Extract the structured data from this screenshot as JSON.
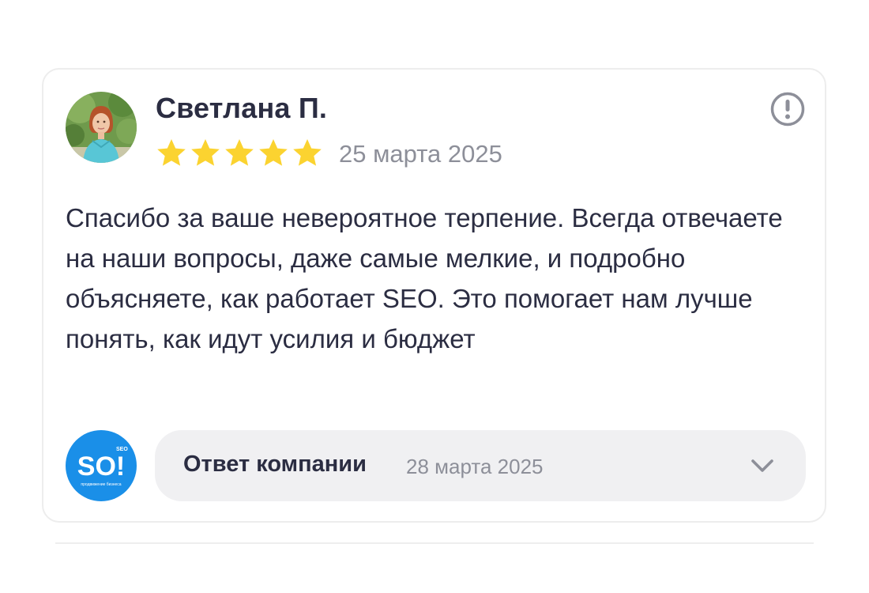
{
  "review": {
    "author_name": "Светлана П.",
    "rating": 5,
    "rating_max": 5,
    "date": "25 марта 2025",
    "text": "Спасибо за ваше невероятное терпение. Всегда отвечаете на наши вопросы, даже самые мелкие, и подробно объясняете, как работает SEO. Это помогает нам лучше понять, как идут усилия и бюджет"
  },
  "icons": {
    "report": "exclamation-circle-icon",
    "star": "star-icon",
    "expand": "chevron-down-icon"
  },
  "company": {
    "logo_text": "SO!",
    "logo_small_text": "SEO",
    "logo_tagline": "продвижение бизнеса",
    "logo_color": "#1a8fe8"
  },
  "response": {
    "title": "Ответ компании",
    "date": "28 марта 2025"
  },
  "colors": {
    "star": "#fbd330",
    "text": "#2b2d42",
    "muted": "#8d8f99",
    "response_bg": "#f0f0f2",
    "card_border": "#ededed"
  }
}
